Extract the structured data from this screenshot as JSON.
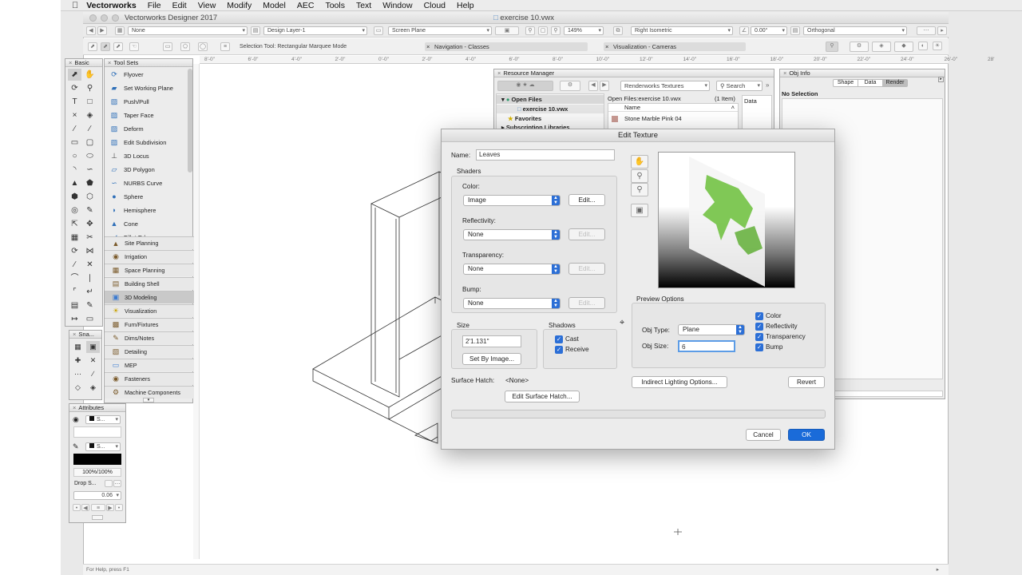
{
  "menubar": {
    "apple_icon": "apple-icon",
    "app_name": "Vectorworks",
    "items": [
      "File",
      "Edit",
      "View",
      "Modify",
      "Model",
      "AEC",
      "Tools",
      "Text",
      "Window",
      "Cloud",
      "Help"
    ]
  },
  "window": {
    "app_title": "Vectorworks Designer 2017",
    "doc_title": "exercise 10.vwx"
  },
  "toolbar": {
    "class_value": "None",
    "layer_value": "Design Layer-1",
    "plane_value": "Screen Plane",
    "zoom_value": "149%",
    "view_value": "Right Isometric",
    "angle_value": "0.00°",
    "projection_value": "Orthogonal",
    "mode_hint": "Selection Tool: Rectangular Marquee Mode",
    "nav_palette": "Navigation - Classes",
    "vis_palette": "Visualization - Cameras"
  },
  "ruler": {
    "labels": [
      "8'-0\"",
      "6'-0\"",
      "4'-0\"",
      "2'-0\"",
      "0'-0\"",
      "2'-0\"",
      "4'-0\"",
      "6'-0\"",
      "8'-0\"",
      "10'-0\"",
      "12'-0\"",
      "14'-0\"",
      "16'-0\"",
      "18'-0\"",
      "20'-0\"",
      "22'-0\"",
      "24'-0\"",
      "26'-0\"",
      "28'"
    ]
  },
  "status": {
    "help": "For Help, press F1"
  },
  "basic_palette": {
    "title": "Basic"
  },
  "tool_sets": {
    "title": "Tool Sets",
    "tools": [
      {
        "icon": "flyover-icon",
        "label": "Flyover"
      },
      {
        "icon": "working-plane-icon",
        "label": "Set Working Plane"
      },
      {
        "icon": "push-pull-icon",
        "label": "Push/Pull"
      },
      {
        "icon": "taper-face-icon",
        "label": "Taper Face"
      },
      {
        "icon": "deform-icon",
        "label": "Deform"
      },
      {
        "icon": "edit-subdivision-icon",
        "label": "Edit Subdivision"
      },
      {
        "icon": "3d-locus-icon",
        "label": "3D Locus"
      },
      {
        "icon": "3d-polygon-icon",
        "label": "3D Polygon"
      },
      {
        "icon": "nurbs-curve-icon",
        "label": "NURBS Curve"
      },
      {
        "icon": "sphere-icon",
        "label": "Sphere"
      },
      {
        "icon": "hemisphere-icon",
        "label": "Hemisphere"
      },
      {
        "icon": "cone-icon",
        "label": "Cone"
      },
      {
        "icon": "fillet-edge-icon",
        "label": "Fillet Edge"
      }
    ],
    "workspaces": [
      {
        "label": "Site Planning",
        "selected": false
      },
      {
        "label": "Irrigation",
        "selected": false
      },
      {
        "label": "Space Planning",
        "selected": false
      },
      {
        "label": "Building Shell",
        "selected": false
      },
      {
        "label": "3D Modeling",
        "selected": true
      },
      {
        "label": "Visualization",
        "selected": false
      },
      {
        "label": "Furn/Fixtures",
        "selected": false
      },
      {
        "label": "Dims/Notes",
        "selected": false
      },
      {
        "label": "Detailing",
        "selected": false
      },
      {
        "label": "MEP",
        "selected": false
      },
      {
        "label": "Fasteners",
        "selected": false
      },
      {
        "label": "Machine Components",
        "selected": false
      }
    ]
  },
  "snapping": {
    "title": "Sna..."
  },
  "attributes": {
    "title": "Attributes",
    "fill_value": "S...",
    "pen_value": "S...",
    "opacity": "100%/100%",
    "drop_shadow": "Drop S...",
    "line_weight": "0.06"
  },
  "resource_manager": {
    "title": "Resource Manager",
    "type_value": "Renderworks Textures",
    "search_placeholder": "Search",
    "tree": [
      "Open Files",
      "exercise 10.vwx",
      "Favorites",
      "Subscription Libraries"
    ],
    "path": "Open Files:exercise 10.vwx",
    "count": "(1 Item)",
    "col_name": "Name",
    "col_data": "Data",
    "items": [
      "Stone Marble Pink 04"
    ]
  },
  "obj_info": {
    "title": "Obj Info",
    "tabs": [
      "Shape",
      "Data",
      "Render"
    ],
    "active_tab": "Render",
    "selection": "No Selection"
  },
  "edit_texture": {
    "title": "Edit Texture",
    "name_label": "Name:",
    "name_value": "Leaves",
    "shaders_label": "Shaders",
    "color_label": "Color:",
    "color_value": "Image",
    "reflectivity_label": "Reflectivity:",
    "reflectivity_value": "None",
    "transparency_label": "Transparency:",
    "transparency_value": "None",
    "bump_label": "Bump:",
    "bump_value": "None",
    "edit_label": "Edit...",
    "size_label": "Size",
    "size_value": "2'1.131\"",
    "set_by_image": "Set By Image...",
    "shadows_label": "Shadows",
    "cast_label": "Cast",
    "receive_label": "Receive",
    "surface_hatch_label": "Surface Hatch:",
    "surface_hatch_value": "<None>",
    "edit_surface_hatch": "Edit Surface Hatch...",
    "preview_options_label": "Preview Options",
    "obj_type_label": "Obj Type:",
    "obj_type_value": "Plane",
    "obj_size_label": "Obj Size:",
    "obj_size_value": "6",
    "preview_checks": [
      "Color",
      "Reflectivity",
      "Transparency",
      "Bump"
    ],
    "indirect_lighting": "Indirect Lighting Options...",
    "revert": "Revert",
    "cancel": "Cancel",
    "ok": "OK",
    "accent": "#1a6bd9"
  }
}
